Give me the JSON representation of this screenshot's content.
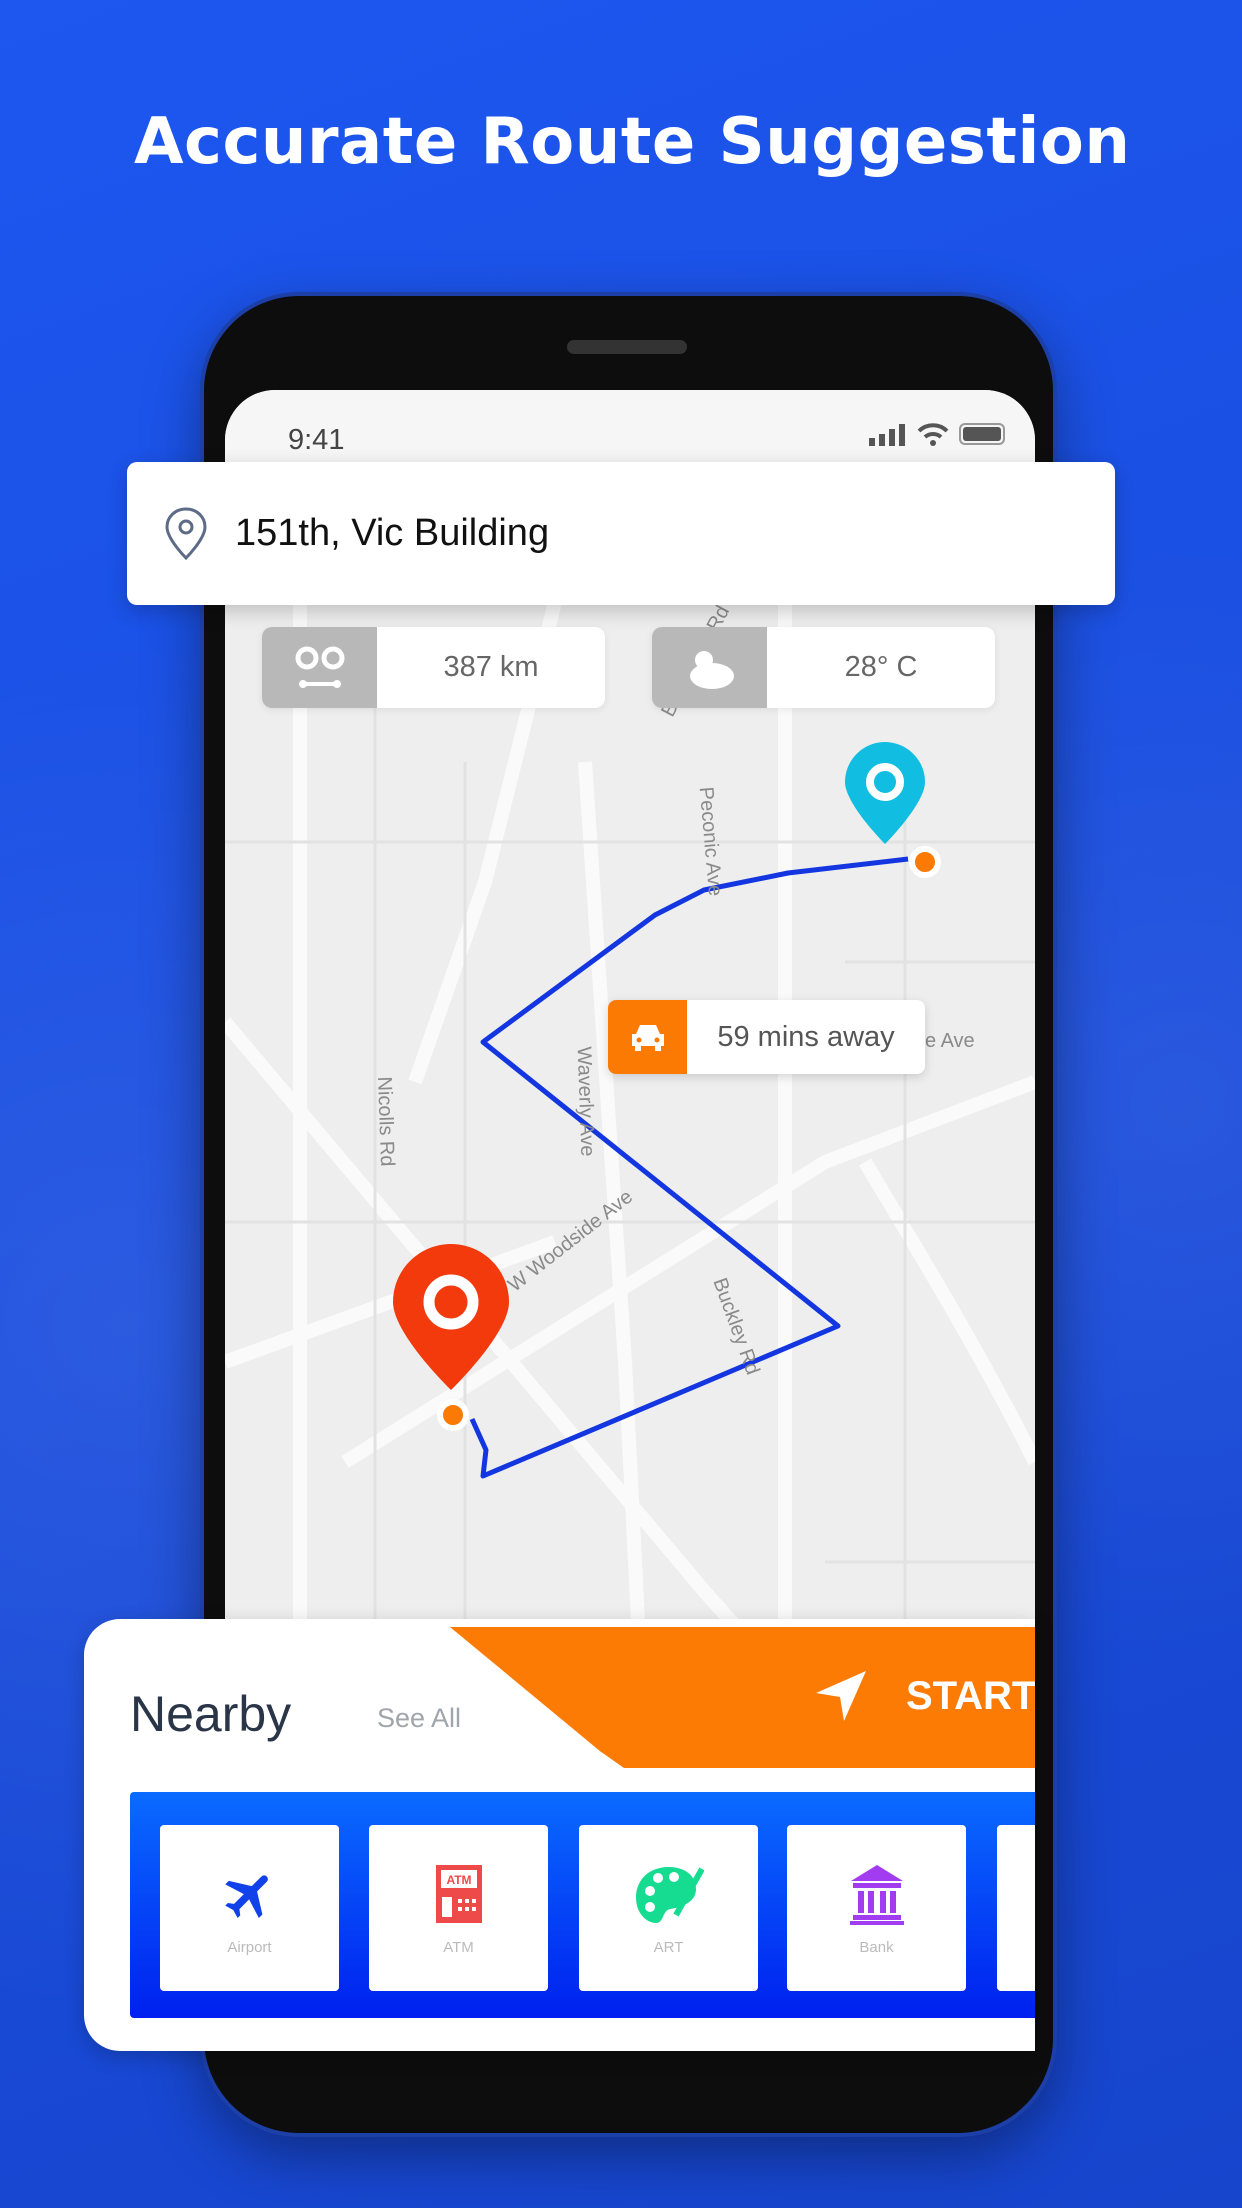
{
  "headline": "Accurate Route Suggestion",
  "status_bar": {
    "time": "9:41"
  },
  "search": {
    "value": "151th, Vic Building",
    "icon": "location-pin-icon"
  },
  "stats": [
    {
      "icon": "distance-icon",
      "value": "387 km"
    },
    {
      "icon": "weather-icon",
      "value": "28° C"
    }
  ],
  "eta": {
    "icon": "car-icon",
    "value": "59 mins away"
  },
  "streets": [
    "Blue Point Rd",
    "Peconic Ave",
    "Nicolls Rd",
    "Waverly Ave",
    "W Woodside Ave",
    "Buckley Rd",
    "e Ave"
  ],
  "colors": {
    "accent_orange": "#fb7b05",
    "route_blue": "#1336e0",
    "destination_pin": "#11bde0",
    "origin_pin": "#f23a0c",
    "background": "#1a4ee0"
  },
  "nearby": {
    "title": "Nearby",
    "see_all": "See All",
    "start_label": "START",
    "items": [
      {
        "label": "Airport",
        "icon": "airplane-icon",
        "color": "#1141e8"
      },
      {
        "label": "ATM",
        "icon": "atm-icon",
        "color": "#ee4a4a"
      },
      {
        "label": "ART",
        "icon": "palette-icon",
        "color": "#16dc92"
      },
      {
        "label": "Bank",
        "icon": "bank-icon",
        "color": "#a23cf0"
      }
    ]
  }
}
